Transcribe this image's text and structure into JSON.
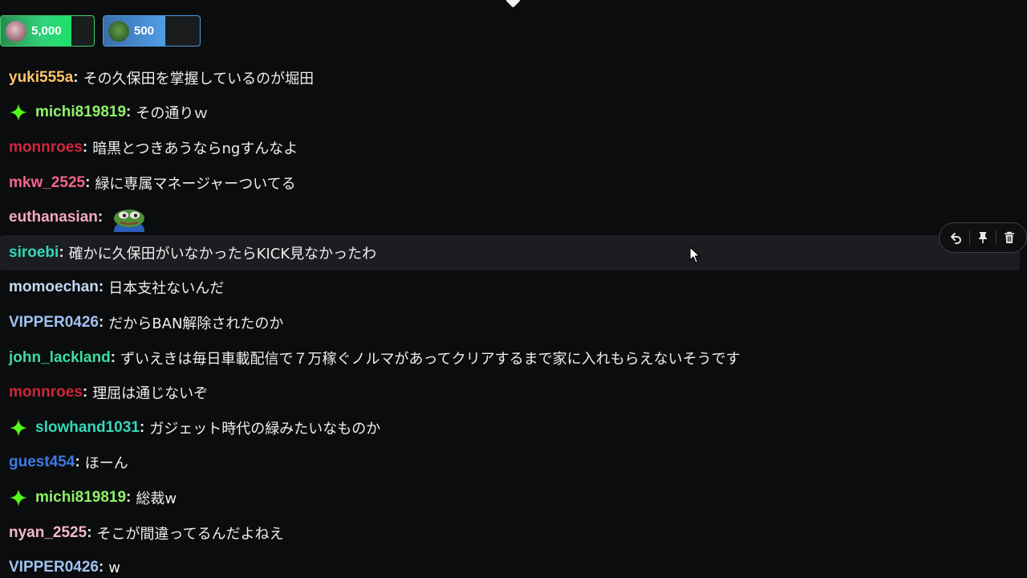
{
  "gifts": [
    {
      "amount": "5,000",
      "color": "#30d37a"
    },
    {
      "amount": "500",
      "color": "#4f9fe6"
    }
  ],
  "messages": [
    {
      "user": "yuki555a",
      "color": "#ffc36b",
      "badge": false,
      "text": "その久保田を掌握しているのが堀田"
    },
    {
      "user": "michi819819",
      "color": "#8ff26b",
      "badge": true,
      "text": "その通りｗ"
    },
    {
      "user": "monnroes",
      "color": "#d1253a",
      "badge": false,
      "text": "暗黒とつきあうならngすんなよ"
    },
    {
      "user": "mkw_2525",
      "color": "#f2648a",
      "badge": false,
      "text": "緑に専属マネージャーついてる"
    },
    {
      "user": "euthanasian",
      "color": "#f5a9bd",
      "badge": false,
      "text": "",
      "emote": "pepe-frog-emote"
    },
    {
      "user": "siroebi",
      "color": "#33d9b8",
      "badge": false,
      "text": "確かに久保田がいなかったらKICK見なかったわ"
    },
    {
      "user": "momoechan",
      "color": "#c2d8f5",
      "badge": false,
      "text": "日本支社ないんだ"
    },
    {
      "user": "VIPPER0426",
      "color": "#9fc3f0",
      "badge": false,
      "text": "だからBAN解除されたのか"
    },
    {
      "user": "john_lackland",
      "color": "#3ddca0",
      "badge": false,
      "text": "ずいえきは毎日車載配信で７万稼ぐノルマがあってクリアするまで家に入れもらえないそうです"
    },
    {
      "user": "monnroes",
      "color": "#d1253a",
      "badge": false,
      "text": "理屈は通じないぞ"
    },
    {
      "user": "slowhand1031",
      "color": "#33d9b8",
      "badge": true,
      "text": "ガジェット時代の緑みたいなものか"
    },
    {
      "user": "guest454",
      "color": "#3b7be8",
      "badge": false,
      "text": "ほーん"
    },
    {
      "user": "michi819819",
      "color": "#8ff26b",
      "badge": true,
      "text": "総裁w"
    },
    {
      "user": "nyan_2525",
      "color": "#f5b7cc",
      "badge": false,
      "text": "そこが間違ってるんだよねえ"
    },
    {
      "user": "VIPPER0426",
      "color": "#9fc3f0",
      "badge": false,
      "text": "w"
    }
  ],
  "mod_actions": [
    "reply-icon",
    "pin-icon",
    "delete-icon"
  ]
}
